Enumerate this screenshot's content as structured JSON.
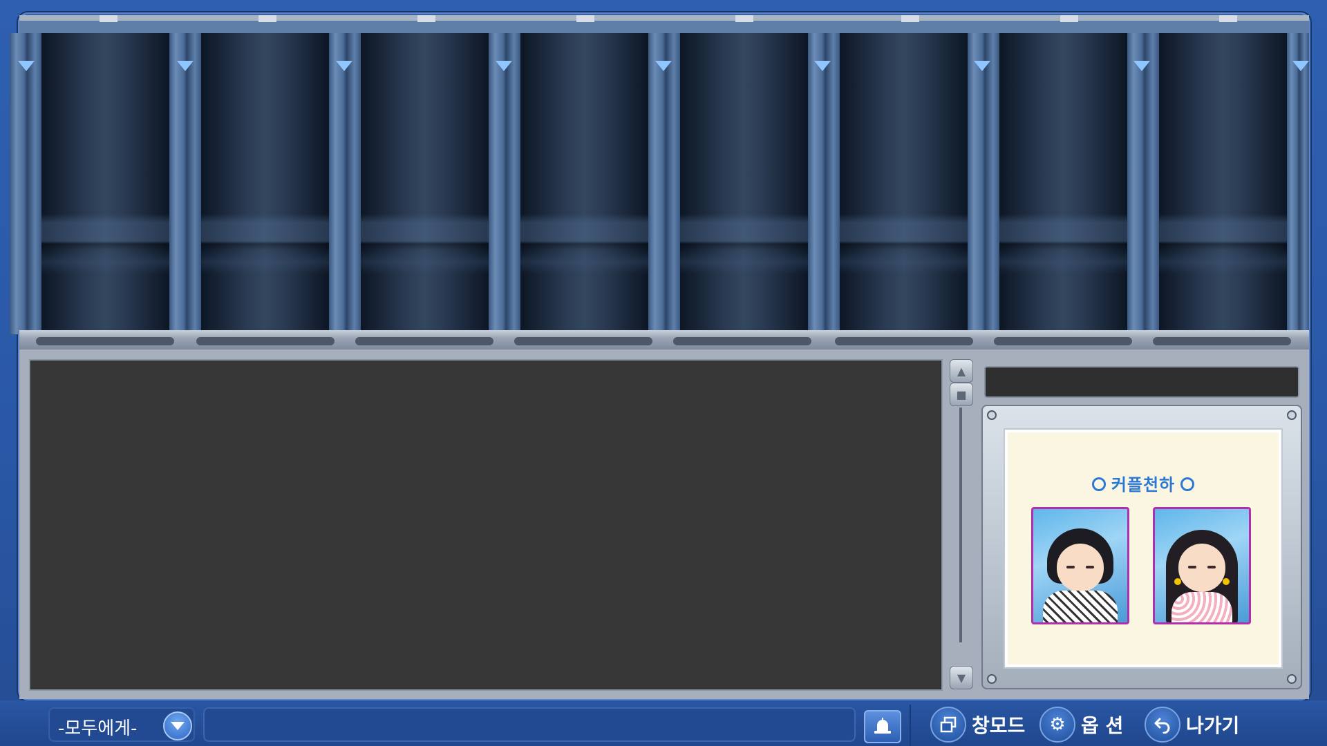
{
  "top_panel": {
    "slot_count": 8
  },
  "couple_panel": {
    "title": "커플천하",
    "partners": [
      {
        "name": "male-avatar"
      },
      {
        "name": "female-avatar"
      }
    ]
  },
  "bottom_bar": {
    "target_label": "-모두에게-",
    "chat_placeholder": "",
    "window_mode_label": "창모드",
    "options_label": "옵 션",
    "exit_label": "나가기"
  },
  "icons": {
    "target_dropdown": "chevron-down-icon",
    "alert": "bell-icon",
    "window_mode": "window-icon",
    "options": "gear-icon",
    "exit": "back-arrow-icon"
  },
  "colors": {
    "background_blue": "#2f5fb0",
    "accent_blue": "#2c78d6",
    "chat_bg": "#373737",
    "avatar_border": "#b22fa8"
  }
}
